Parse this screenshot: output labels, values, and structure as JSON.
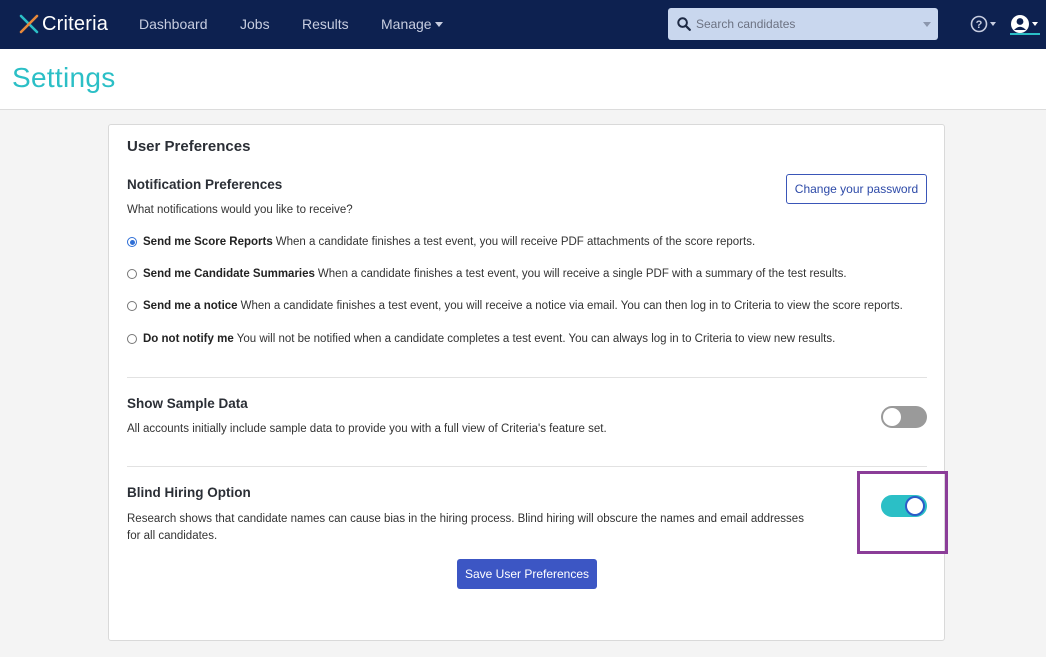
{
  "brand": {
    "name": "Criteria",
    "accent": "#2bbfc6",
    "navy": "#0d2150"
  },
  "nav": {
    "items": [
      "Dashboard",
      "Jobs",
      "Results",
      "Manage"
    ],
    "search_placeholder": "Search candidates"
  },
  "page": {
    "title": "Settings"
  },
  "preferences": {
    "card_title": "User Preferences",
    "notification": {
      "title": "Notification Preferences",
      "question": "What notifications would you like to receive?",
      "change_password_label": "Change your password",
      "options": [
        {
          "label": "Send me Score Reports",
          "desc": "When a candidate finishes a test event, you will receive PDF attachments of the score reports.",
          "checked": true
        },
        {
          "label": "Send me Candidate Summaries",
          "desc": "When a candidate finishes a test event, you will receive a single PDF with a summary of the test results.",
          "checked": false
        },
        {
          "label": "Send me a notice",
          "desc": "When a candidate finishes a test event, you will receive a notice via email. You can then log in to Criteria to view the score reports.",
          "checked": false
        },
        {
          "label": "Do not notify me",
          "desc": "You will not be notified when a candidate completes a test event. You can always log in to Criteria to view new results.",
          "checked": false
        }
      ]
    },
    "sample_data": {
      "title": "Show Sample Data",
      "desc": "All accounts initially include sample data to provide you with a full view of Criteria's feature set.",
      "enabled": false
    },
    "blind_hiring": {
      "title": "Blind Hiring Option",
      "desc_line1": "Research shows that candidate names can cause bias in the hiring process. Blind hiring will obscure the names and email addresses",
      "desc_line2": "for all candidates.",
      "enabled": true
    },
    "save_label": "Save User Preferences"
  }
}
